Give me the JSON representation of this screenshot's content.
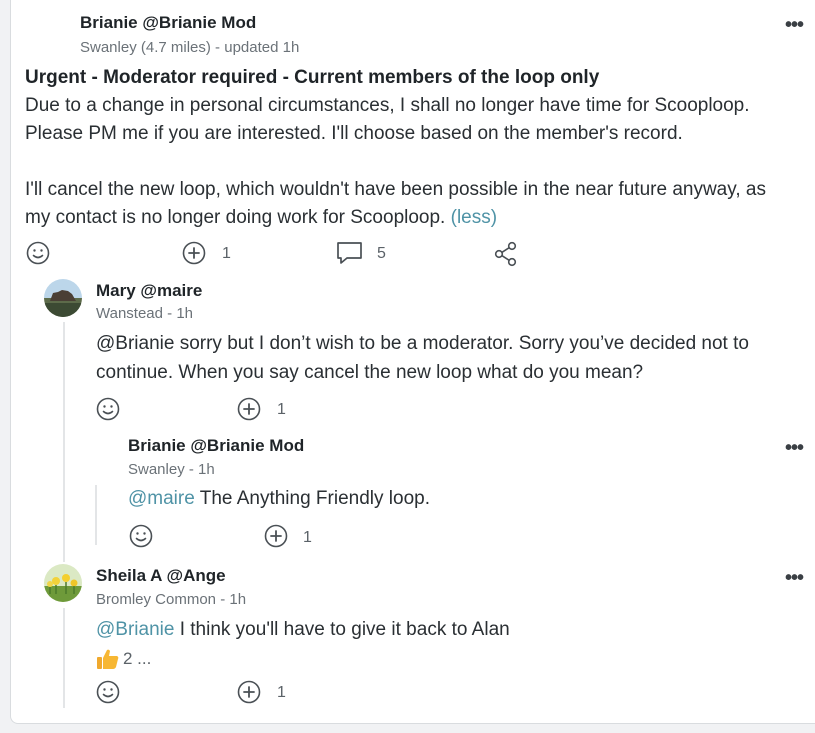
{
  "post": {
    "author": "Brianie @Brianie Mod",
    "location": "Swanley (4.7 miles)",
    "updated": "updated 1h",
    "title": "Urgent - Moderator required - Current members of the loop only",
    "para1_line1": "Due to a change in personal circumstances, I shall no longer have time for Scooploop.",
    "para1_line2": "Please PM me if you are interested. I'll choose based on the member's record.",
    "para2_line1": "I'll cancel the new loop, which wouldn't have been possible in the near future anyway, as",
    "para2_line2": "my contact is no longer doing work for Scooploop.",
    "less_link": "(less)",
    "like_count": "1",
    "comment_count": "5"
  },
  "comments": [
    {
      "author": "Mary @maire",
      "location": "Wanstead",
      "time": "1h",
      "line1": "@Brianie sorry but I don’t wish to be a moderator. Sorry you’ve decided not to",
      "line2": "continue. When you say cancel the new loop what do you mean?",
      "like_count": "1"
    },
    {
      "author": "Brianie @Brianie Mod",
      "location": "Swanley",
      "time": "1h",
      "mention": "@maire",
      "text": " The Anything Friendly loop.",
      "like_count": "1"
    },
    {
      "author": "Sheila A @Ange",
      "location": "Bromley Common",
      "time": "1h",
      "mention": "@Brianie",
      "text": " I think you'll have to give it back to Alan",
      "reaction_count": "2 ...",
      "like_count": "1"
    }
  ],
  "separator": " - ",
  "colors": {
    "link": "#4f93a6",
    "text": "#2a2f33",
    "meta": "#6b7278",
    "thread": "#e3e5e7"
  },
  "icons": [
    "smiley-icon",
    "plus-circle-icon",
    "speech-bubble-icon",
    "share-icon",
    "more-dots-icon",
    "thumbs-up-icon"
  ]
}
